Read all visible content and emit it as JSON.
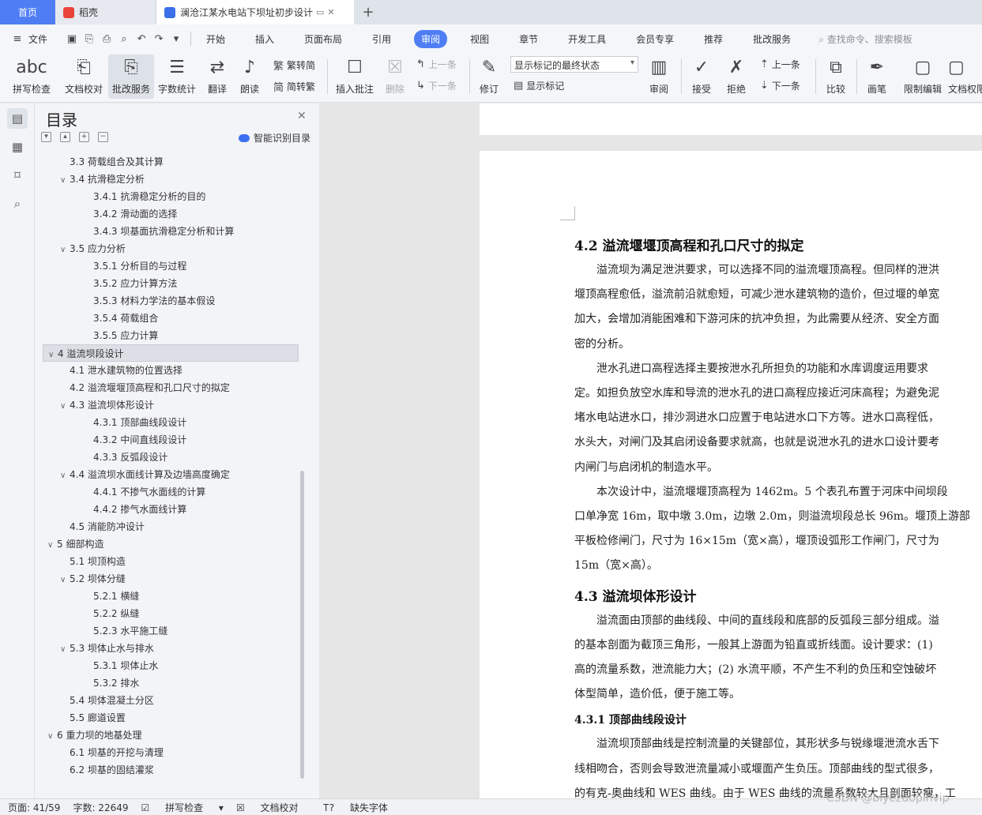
{
  "tabs": {
    "home": "首页",
    "daoke": "稻壳",
    "doc": "澜沧江某水电站下坝址初步设计",
    "add": "+"
  },
  "menu": {
    "file": "文件",
    "items": [
      "开始",
      "插入",
      "页面布局",
      "引用",
      "审阅",
      "视图",
      "章节",
      "开发工具",
      "会员专享",
      "推荐",
      "批改服务"
    ],
    "active_index": 4,
    "search": "查找命令、搜索模板"
  },
  "ribbon": {
    "spellcheck": "拼写检查",
    "doccheck": "文档校对",
    "review_service": "批改服务",
    "wordcount": "字数统计",
    "translate": "翻译",
    "read": "朗读",
    "to_trad": "繁转简",
    "to_simp": "简转繁",
    "insert_comment": "插入批注",
    "delete": "删除",
    "prev": "上一条",
    "next": "下一条",
    "revise": "修订",
    "markup_select": "显示标记的最终状态",
    "show_markup": "显示标记",
    "review": "审阅",
    "accept": "接受",
    "reject": "拒绝",
    "prev2": "上一条",
    "next2": "下一条",
    "compare": "比较",
    "ink": "画笔",
    "restrict": "限制编辑",
    "perm": "文档权限"
  },
  "toc": {
    "title": "目录",
    "smart": "智能识别目录",
    "items": [
      {
        "text": "3.3 荷载组合及其计算",
        "level": 2,
        "arrow": false
      },
      {
        "text": "3.4 抗滑稳定分析",
        "level": 2,
        "arrow": true
      },
      {
        "text": "3.4.1 抗滑稳定分析的目的",
        "level": 3,
        "arrow": false
      },
      {
        "text": "3.4.2 滑动面的选择",
        "level": 3,
        "arrow": false
      },
      {
        "text": "3.4.3 坝基面抗滑稳定分析和计算",
        "level": 3,
        "arrow": false
      },
      {
        "text": "3.5 应力分析",
        "level": 2,
        "arrow": true
      },
      {
        "text": "3.5.1  分析目的与过程",
        "level": 3,
        "arrow": false
      },
      {
        "text": "3.5.2  应力计算方法",
        "level": 3,
        "arrow": false
      },
      {
        "text": "3.5.3  材料力学法的基本假设",
        "level": 3,
        "arrow": false
      },
      {
        "text": "3.5.4 荷载组合",
        "level": 3,
        "arrow": false
      },
      {
        "text": "3.5.5 应力计算",
        "level": 3,
        "arrow": false
      },
      {
        "text": "4  溢流坝段设计",
        "level": 1,
        "arrow": true,
        "selected": true
      },
      {
        "text": "4.1 泄水建筑物的位置选择",
        "level": 2,
        "arrow": false
      },
      {
        "text": "4.2 溢流堰堰顶高程和孔口尺寸的拟定",
        "level": 2,
        "arrow": false
      },
      {
        "text": "4.3 溢流坝体形设计",
        "level": 2,
        "arrow": true
      },
      {
        "text": "4.3.1 顶部曲线段设计",
        "level": 3,
        "arrow": false
      },
      {
        "text": "4.3.2 中间直线段设计",
        "level": 3,
        "arrow": false
      },
      {
        "text": "4.3.3 反弧段设计",
        "level": 3,
        "arrow": false
      },
      {
        "text": "4.4 溢流坝水面线计算及边墙高度确定",
        "level": 2,
        "arrow": true
      },
      {
        "text": "4.4.1 不掺气水面线的计算",
        "level": 3,
        "arrow": false
      },
      {
        "text": "4.4.2 掺气水面线计算",
        "level": 3,
        "arrow": false
      },
      {
        "text": "4.5 消能防冲设计",
        "level": 2,
        "arrow": false
      },
      {
        "text": "5  细部构造",
        "level": 1,
        "arrow": true
      },
      {
        "text": "5.1 坝顶构造",
        "level": 2,
        "arrow": false
      },
      {
        "text": "5.2 坝体分缝",
        "level": 2,
        "arrow": true
      },
      {
        "text": "5.2.1 横缝",
        "level": 3,
        "arrow": false
      },
      {
        "text": "5.2.2 纵缝",
        "level": 3,
        "arrow": false
      },
      {
        "text": "5.2.3 水平施工缝",
        "level": 3,
        "arrow": false
      },
      {
        "text": "5.3 坝体止水与排水",
        "level": 2,
        "arrow": true
      },
      {
        "text": "5.3.1 坝体止水",
        "level": 3,
        "arrow": false
      },
      {
        "text": "5.3.2 排水",
        "level": 3,
        "arrow": false
      },
      {
        "text": "5.4 坝体混凝土分区",
        "level": 2,
        "arrow": false
      },
      {
        "text": "5.5 廊道设置",
        "level": 2,
        "arrow": false
      },
      {
        "text": "6  重力坝的地基处理",
        "level": 1,
        "arrow": true
      },
      {
        "text": "6.1 坝基的开挖与清理",
        "level": 2,
        "arrow": false
      },
      {
        "text": "6.2 坝基的固结灌浆",
        "level": 2,
        "arrow": false
      }
    ]
  },
  "doc": {
    "h42": "4.2 溢流堰堰顶高程和孔口尺寸的拟定",
    "p1": [
      "　　溢流坝为满足泄洪要求，可以选择不同的溢流堰顶高程。但同样的泄洪",
      "堰顶高程愈低，溢流前沿就愈短，可减少泄水建筑物的造价，但过堰的单宽",
      "加大，会增加消能困难和下游河床的抗冲负担，为此需要从经济、安全方面",
      "密的分析。"
    ],
    "p2": [
      "　　泄水孔进口高程选择主要按泄水孔所担负的功能和水库调度运用要求",
      "定。如担负放空水库和导流的泄水孔的进口高程应接近河床高程；为避免泥",
      "堵水电站进水口，排沙洞进水口应置于电站进水口下方等。进水口高程低，",
      "水头大，对闸门及其启闭设备要求就高，也就是说泄水孔的进水口设计要考",
      "内闸门与启闭机的制造水平。"
    ],
    "p3": [
      "　　本次设计中，溢流堰堰顶高程为 1462m。5 个表孔布置于河床中间坝段",
      "口单净宽 16m，取中墩 3.0m，边墩 2.0m，则溢流坝段总长 96m。堰顶上游部",
      "平板检修闸门，尺寸为 16×15m（宽×高），堰顶设弧形工作闸门，尺寸为",
      "15m（宽×高）。"
    ],
    "h43": "4.3 溢流坝体形设计",
    "p4": [
      "　　溢流面由顶部的曲线段、中间的直线段和底部的反弧段三部分组成。溢",
      "的基本剖面为截顶三角形，一般其上游面为铅直或折线面。设计要求：(1)",
      "高的流量系数，泄流能力大；(2) 水流平顺，不产生不利的负压和空蚀破坏",
      "体型简单，造价低，便于施工等。"
    ],
    "h431": "4.3.1 顶部曲线段设计",
    "p5": [
      "　　溢流坝顶部曲线是控制流量的关键部位，其形状多与锐缘堰泄流水舌下",
      "线相吻合，否则会导致泄流量减小或堰面产生负压。顶部曲线的型式很多，",
      "的有克-奥曲线和 WES 曲线。由于 WES 曲线的流量系数较大且剖面较瘦，工"
    ]
  },
  "status": {
    "page": "页面: 41/59",
    "words": "字数: 22649",
    "spell": "拼写检查",
    "proof": "文档校对",
    "font": "缺失字体"
  },
  "watermark": "CSDN @biyezuopinvip"
}
